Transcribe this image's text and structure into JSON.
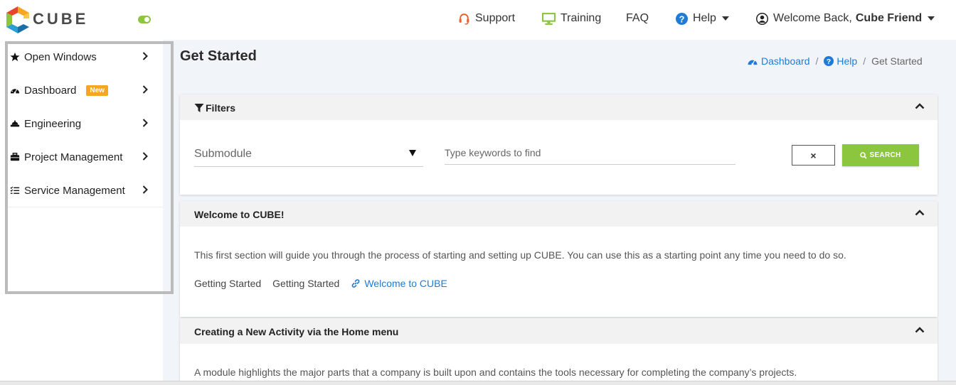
{
  "header": {
    "logo_text": "CUBE",
    "nav": {
      "support": "Support",
      "training": "Training",
      "faq": "FAQ",
      "help": "Help",
      "welcome_prefix": "Welcome Back,",
      "user_name": "Cube Friend"
    }
  },
  "sidebar": {
    "items": [
      {
        "label": "Open Windows",
        "icon": "star-icon"
      },
      {
        "label": "Dashboard",
        "icon": "dashboard-icon",
        "badge": "New"
      },
      {
        "label": "Engineering",
        "icon": "engineering-icon"
      },
      {
        "label": "Project Management",
        "icon": "briefcase-icon"
      },
      {
        "label": "Service Management",
        "icon": "tasks-icon"
      }
    ]
  },
  "main": {
    "page_title": "Get Started",
    "breadcrumb": [
      "Dashboard",
      "Help",
      "Get Started"
    ],
    "filters": {
      "title": "Filters",
      "submodule_label": "Submodule",
      "keyword_placeholder": "Type keywords to find",
      "clear_label": "×",
      "search_label": "SEARCH"
    },
    "welcome_card": {
      "title": "Welcome to CUBE!",
      "description": "This first section will guide you through the process of starting and setting up CUBE. You can use this as a starting point any time you need to do so.",
      "tag1": "Getting Started",
      "tag2": "Getting Started",
      "link": "Welcome to CUBE"
    },
    "activity_card": {
      "title": "Creating a New Activity via the Home menu",
      "description": "A module highlights the major parts that a company is built upon and contains the tools necessary for completing the company’s projects."
    }
  },
  "colors": {
    "accent_green": "#8cc63f",
    "link_blue": "#1e7bd6",
    "badge_orange": "#f5a623"
  }
}
